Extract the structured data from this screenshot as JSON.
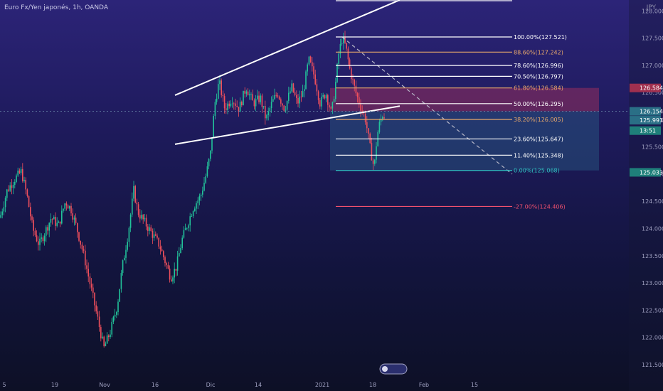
{
  "header": {
    "title": "Euro Fx/Yen japonés, 1h, OANDA",
    "currency": "JPY"
  },
  "chart_data": {
    "type": "candlestick",
    "ylim": [
      121.25,
      128.2
    ],
    "y_ticks": [
      121.5,
      122.0,
      122.5,
      123.0,
      123.5,
      124.0,
      124.5,
      125.0,
      125.5,
      126.0,
      126.5,
      127.0,
      127.5,
      128.0
    ],
    "x_ticks": [
      "5",
      "19",
      "Nov",
      "16",
      "Dic",
      "14",
      "2021",
      "18",
      "Feb",
      "15"
    ],
    "price_path": [
      [
        0,
        124.2
      ],
      [
        10,
        124.7
      ],
      [
        20,
        124.9
      ],
      [
        30,
        125.05
      ],
      [
        38,
        124.6
      ],
      [
        46,
        124.0
      ],
      [
        55,
        123.7
      ],
      [
        62,
        123.9
      ],
      [
        72,
        124.2
      ],
      [
        82,
        124.05
      ],
      [
        92,
        124.5
      ],
      [
        100,
        124.35
      ],
      [
        108,
        124.0
      ],
      [
        118,
        123.5
      ],
      [
        128,
        122.9
      ],
      [
        138,
        122.3
      ],
      [
        146,
        121.8
      ],
      [
        155,
        122.1
      ],
      [
        165,
        122.6
      ],
      [
        172,
        123.3
      ],
      [
        180,
        123.9
      ],
      [
        188,
        124.7
      ],
      [
        194,
        124.3
      ],
      [
        204,
        124.1
      ],
      [
        214,
        123.9
      ],
      [
        224,
        123.7
      ],
      [
        232,
        123.4
      ],
      [
        240,
        123.1
      ],
      [
        248,
        123.3
      ],
      [
        256,
        123.8
      ],
      [
        264,
        124.1
      ],
      [
        272,
        124.4
      ],
      [
        282,
        124.6
      ],
      [
        290,
        125.0
      ],
      [
        296,
        125.4
      ],
      [
        302,
        126.3
      ],
      [
        308,
        126.7
      ],
      [
        316,
        126.2
      ],
      [
        326,
        126.4
      ],
      [
        336,
        126.2
      ],
      [
        346,
        126.6
      ],
      [
        356,
        126.3
      ],
      [
        366,
        126.4
      ],
      [
        374,
        126.0
      ],
      [
        382,
        126.3
      ],
      [
        390,
        126.5
      ],
      [
        400,
        126.2
      ],
      [
        410,
        126.6
      ],
      [
        418,
        126.3
      ],
      [
        426,
        126.5
      ],
      [
        434,
        127.1
      ],
      [
        442,
        126.8
      ],
      [
        450,
        126.3
      ],
      [
        458,
        126.5
      ],
      [
        466,
        126.1
      ],
      [
        472,
        126.7
      ],
      [
        476,
        127.2
      ],
      [
        481,
        127.5
      ],
      [
        486,
        127.35
      ],
      [
        492,
        126.9
      ],
      [
        500,
        126.5
      ],
      [
        508,
        126.2
      ],
      [
        514,
        126.0
      ],
      [
        520,
        125.5
      ],
      [
        526,
        125.1
      ],
      [
        530,
        125.7
      ],
      [
        534,
        125.95
      ],
      [
        538,
        126.1
      ],
      [
        541,
        126.05
      ]
    ],
    "trendlines": [
      {
        "p1": [
          "Dic",
          126.45
        ],
        "p2": [
          "Feb",
          128.2
        ]
      },
      {
        "p1": [
          "Dic",
          125.55
        ],
        "p2": [
          "Feb",
          126.25
        ]
      }
    ],
    "current_price": 126.154,
    "fibonacci": [
      {
        "label": "100.00%(127.521)",
        "level": 127.521,
        "color": "#ffffff"
      },
      {
        "label": "88.60%(127.242)",
        "level": 127.242,
        "color": "#e8a86b"
      },
      {
        "label": "78.60%(126.996)",
        "level": 126.996,
        "color": "#ffffff"
      },
      {
        "label": "70.50%(126.797)",
        "level": 126.797,
        "color": "#ffffff"
      },
      {
        "label": "61.80%(126.584)",
        "level": 126.584,
        "color": "#e8a86b"
      },
      {
        "label": "50.00%(126.295)",
        "level": 126.295,
        "color": "#ffffff"
      },
      {
        "label": "38.20%(126.005)",
        "level": 126.005,
        "color": "#e8a86b"
      },
      {
        "label": "23.60%(125.647)",
        "level": 125.647,
        "color": "#ffffff"
      },
      {
        "label": "11.40%(125.348)",
        "level": 125.348,
        "color": "#ffffff"
      },
      {
        "label": "0.00%(125.068)",
        "level": 125.068,
        "color": "#2fc2c2"
      },
      {
        "label": "-27.00%(124.406)",
        "level": 124.406,
        "color": "#f0506e"
      }
    ],
    "price_tags": [
      {
        "label": "126.584",
        "value": 126.584,
        "color": "#a0304f"
      },
      {
        "label": "126.154",
        "value": 126.154,
        "color": "#2a6f86"
      },
      {
        "label": "125.991",
        "value": 125.991,
        "color": "#2a6f86"
      },
      {
        "label": "13:51",
        "value": 125.8,
        "color": "#1f7f7a"
      },
      {
        "label": "125.033",
        "value": 125.033,
        "color": "#1f7f7a"
      }
    ]
  },
  "axis": {
    "y_labels": [
      "121.500",
      "122.000",
      "122.500",
      "123.000",
      "123.500",
      "124.000",
      "124.500",
      "125.000",
      "125.500",
      "126.000",
      "126.500",
      "127.000",
      "127.500",
      "128.000"
    ]
  }
}
